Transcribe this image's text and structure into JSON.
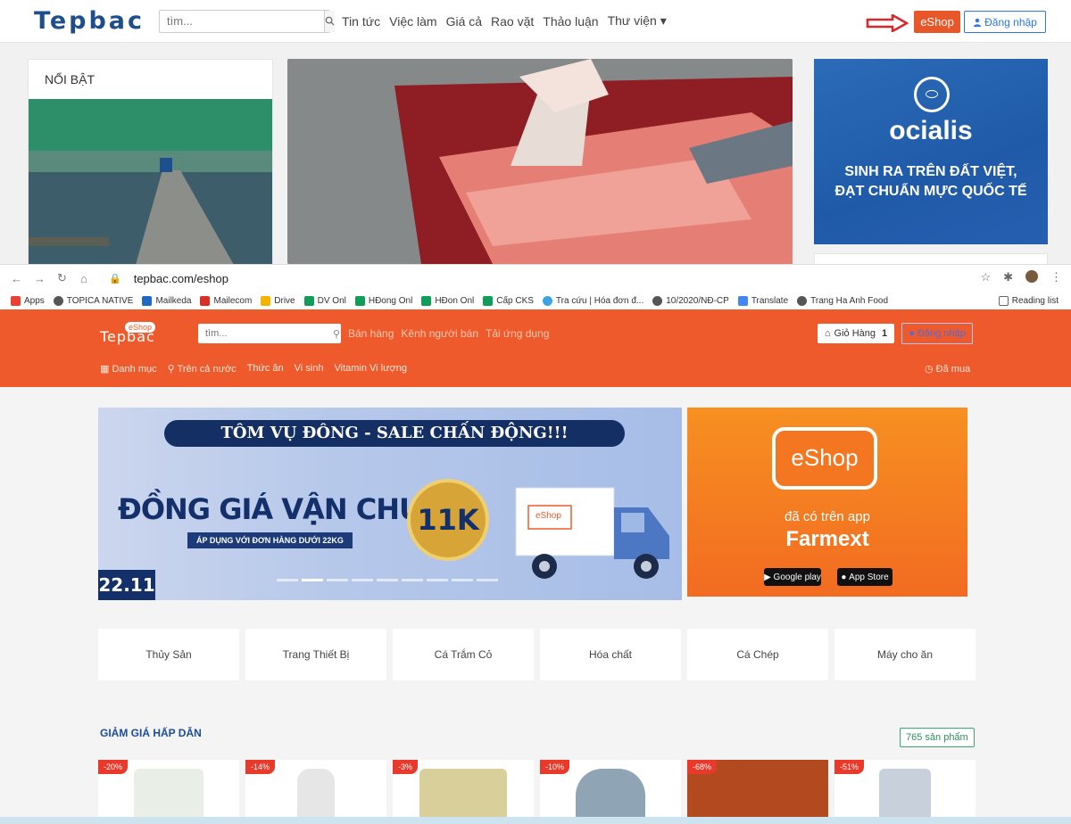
{
  "site": {
    "logo": "Tepbac",
    "search_placeholder": "tìm...",
    "nav": [
      "Tin tức",
      "Việc làm",
      "Giá cả",
      "Rao vặt",
      "Thảo luận",
      "Thư viện ▾"
    ],
    "eshop_button": "eShop",
    "login_button": "Đăng nhập",
    "featured_title": "NỔI BẬT",
    "ad": {
      "brand": "ocialis",
      "line1": "SINH RA TRÊN ĐẤT VIỆT,",
      "line2": "ĐẠT CHUẨN MỰC QUỐC TẾ"
    }
  },
  "browser": {
    "url": "tepbac.com/eshop",
    "bookmarks": [
      "Apps",
      "TOPICA NATIVE",
      "Mailkeda",
      "Mailecom",
      "Drive",
      "DV Onl",
      "HĐong Onl",
      "HĐon Onl",
      "Cấp CKS",
      "Tra cứu | Hóa đơn đ...",
      "10/2020/NĐ-CP",
      "Translate",
      "Trang Ha Anh Food"
    ],
    "reading_list": "Reading list"
  },
  "eshop": {
    "logo": "Tepbac",
    "logo_tag": "eShop",
    "search_placeholder": "tìm...",
    "nav": [
      "Bán hàng",
      "Kênh người bán",
      "Tải ứng dụng"
    ],
    "cart_label": "Giỏ Hàng",
    "cart_count": "1",
    "login_label": "Đăng nhập",
    "menu": [
      "Danh mục",
      "Trên cả nước",
      "Thức ăn",
      "Vi sinh",
      "Vitamin Vi lượng"
    ],
    "bought": "Đã mua",
    "banner": {
      "title": "TÔM VỤ ĐÔNG - SALE CHẤN ĐỘNG!!!",
      "big": "ĐỒNG GIÁ VẬN CHUYỂN",
      "sub": "ÁP DỤNG VỚI ĐƠN HÀNG DƯỚI 22KG",
      "price": "11K",
      "date": "22.11",
      "truck_tag": "eShop"
    },
    "promo": {
      "bag": "eShop",
      "avail": "đã có trên app",
      "app": "Farmext",
      "google": "Google play",
      "apple": "App Store"
    },
    "categories": [
      "Thủy Sản",
      "Trang Thiết Bị",
      "Cá Trắm Cỏ",
      "Hóa chất",
      "Cá Chép",
      "Máy cho ăn"
    ],
    "sale_heading": "GIẢM GIÁ HẤP DẪN",
    "product_count": "765 sản phẩm",
    "discounts": [
      "-20%",
      "-14%",
      "-3%",
      "-10%",
      "-68%",
      "-51%"
    ],
    "product_colors": [
      "#e9efe6",
      "#e6e6e6",
      "#d8cf9a",
      "#8fa5b5",
      "#b34a1f",
      "#c7d0db"
    ]
  },
  "colors": {
    "accent": "#ee5a2b",
    "brand_blue": "#1f4e8c",
    "arrow_red": "#d9262b"
  },
  "icons": [
    "search-icon",
    "caret-down-icon",
    "user-icon",
    "arrow-right-icon",
    "back-icon",
    "forward-icon",
    "reload-icon",
    "home-icon",
    "lock-icon",
    "star-icon",
    "extensions-icon",
    "cart-icon",
    "grid-icon",
    "pin-icon",
    "clock-icon"
  ]
}
